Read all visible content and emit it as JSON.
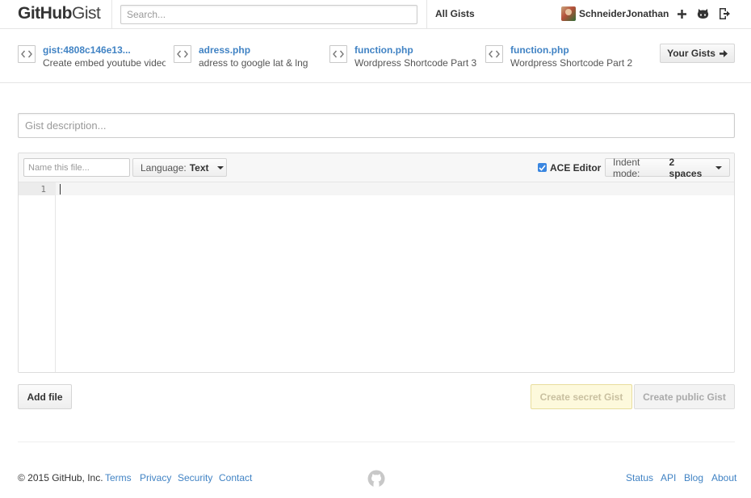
{
  "header": {
    "logo_bold": "GitHub",
    "logo_light": "Gist",
    "search_placeholder": "Search...",
    "all_gists": "All Gists",
    "username": "SchneiderJonathan"
  },
  "recent_gists": [
    {
      "title": "gist:4808c146e13...",
      "description": "Create embed youtube video"
    },
    {
      "title": "adress.php",
      "description": "adress to google lat & lng"
    },
    {
      "title": "function.php",
      "description": "Wordpress Shortcode Part 3"
    },
    {
      "title": "function.php",
      "description": "Wordpress Shortcode Part 2"
    }
  ],
  "your_gists": "Your Gists",
  "form": {
    "description_placeholder": "Gist description...",
    "filename_placeholder": "Name this file...",
    "language_label": "Language:",
    "language_value": "Text",
    "ace_editor_label": "ACE Editor",
    "ace_editor_checked": true,
    "indent_label": "Indent mode:",
    "indent_value": "2 spaces",
    "line_number": "1"
  },
  "actions": {
    "add_file": "Add file",
    "create_secret": "Create secret Gist",
    "create_public": "Create public Gist"
  },
  "footer": {
    "copyright": "© 2015 GitHub, Inc.",
    "left_links": [
      "Terms",
      "Privacy",
      "Security",
      "Contact"
    ],
    "right_links": [
      "Status",
      "API",
      "Blog",
      "About"
    ]
  },
  "colors": {
    "link": "#4183c4",
    "secret_button_bg": "#fdf9dc",
    "checkbox": "#3a86e0"
  }
}
